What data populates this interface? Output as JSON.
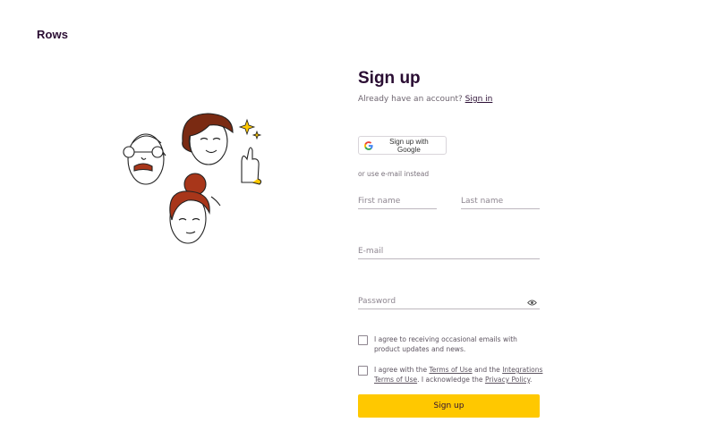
{
  "brand": {
    "name": "Rows"
  },
  "signup": {
    "title": "Sign up",
    "already_text": "Already have an account?",
    "signin_link": "Sign in",
    "google_button": "Sign up with Google",
    "or_text": "or use e-mail instead",
    "first_name_placeholder": "First name",
    "last_name_placeholder": "Last name",
    "email_placeholder": "E-mail",
    "password_placeholder": "Password",
    "marketing_consent": "I agree to receiving occasional emails with product updates and news.",
    "terms": {
      "prefix": "I agree with the",
      "terms_link": "Terms of Use",
      "and": "and the",
      "integrations_link": "Integrations Terms of Use",
      "suffix": ". I acknowledge the",
      "privacy_link": "Privacy Policy",
      "end": "."
    },
    "submit_button": "Sign up"
  },
  "colors": {
    "brand_dark": "#2a0d33",
    "accent_yellow": "#ffc800",
    "hair_brown": "#7a2a12",
    "hair_red": "#a8361a"
  },
  "icons": [
    "google-icon",
    "eye-icon",
    "sparkle-icon"
  ]
}
